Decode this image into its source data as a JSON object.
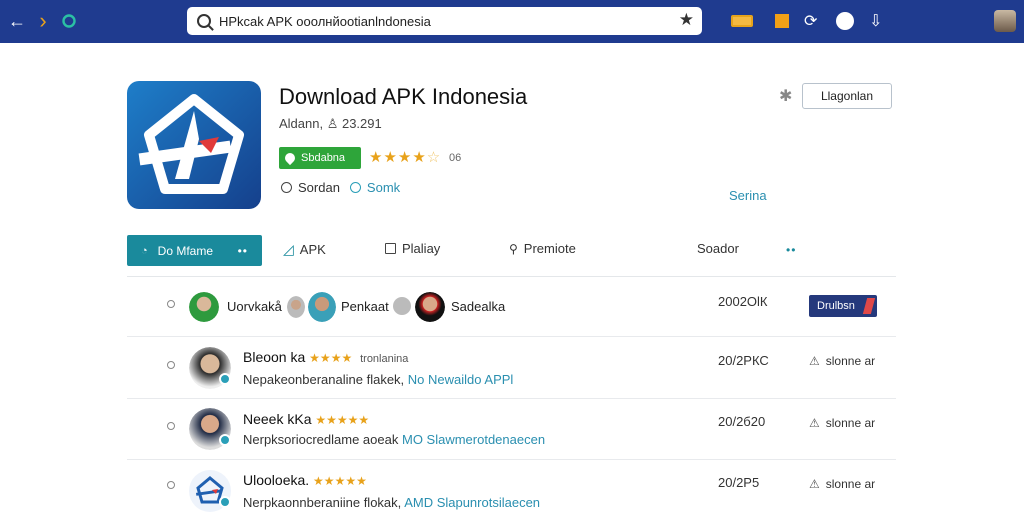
{
  "browser": {
    "url": "HPkcak APK ооолнйооtiаnlndоnesiа",
    "back_glyph": "←",
    "forward_glyph": "›"
  },
  "app": {
    "title": "Download APK Indonesia",
    "meta": "Aldann, ♙ 23.291",
    "install_label": "Sbdabna",
    "stars": "★★★★",
    "stars_dim": "☆",
    "rating_count": "06",
    "link1": "Sоrdаn",
    "link2": "Sоmk",
    "action_button": "Llagonlan",
    "side_link": "Serina"
  },
  "tabs": {
    "active": {
      "icon": "◔",
      "label": "Do Mfame",
      "dots": "••"
    },
    "apk": "APK",
    "library": "Plaliay",
    "profile": "Premiote",
    "sort": "Soador",
    "more": "••"
  },
  "rows": {
    "first": {
      "user1": "Uorvkakå",
      "user2": "Penkaat",
      "user3": "Sadealka",
      "date": "2002ОlК",
      "button": "Drulbsn"
    },
    "items": [
      {
        "name": "Bleoon ka",
        "stars": "★★★★",
        "tag": "tronlanina",
        "desc_plain": "Nepakeonberanaline flakek,",
        "desc_highlight": "No Newaildo APPl",
        "date": "20/2РКС",
        "action": "slonne ar"
      },
      {
        "name": "Neeek kKa",
        "stars": "★★★★★",
        "tag": "",
        "desc_plain": "Nerpksoriocredlame aoeak",
        "desc_highlight": "MO Slawmerotdenaecen",
        "date": "20/2б20",
        "action": "slonne ar"
      },
      {
        "name": "Ulooloeka.",
        "stars": "★★★★★",
        "tag": "",
        "desc_plain": "Nerpkaonnberaniine flokak,",
        "desc_highlight": "AMD Slapunrotsilaecen",
        "date": "20/2Р5",
        "action": "slonne ar"
      }
    ]
  },
  "colors": {
    "topbar": "#1f3b8f",
    "accent_teal": "#1a8a9c",
    "install_green": "#2ea53a",
    "star": "#e8a21b",
    "button_navy": "#25397c"
  }
}
